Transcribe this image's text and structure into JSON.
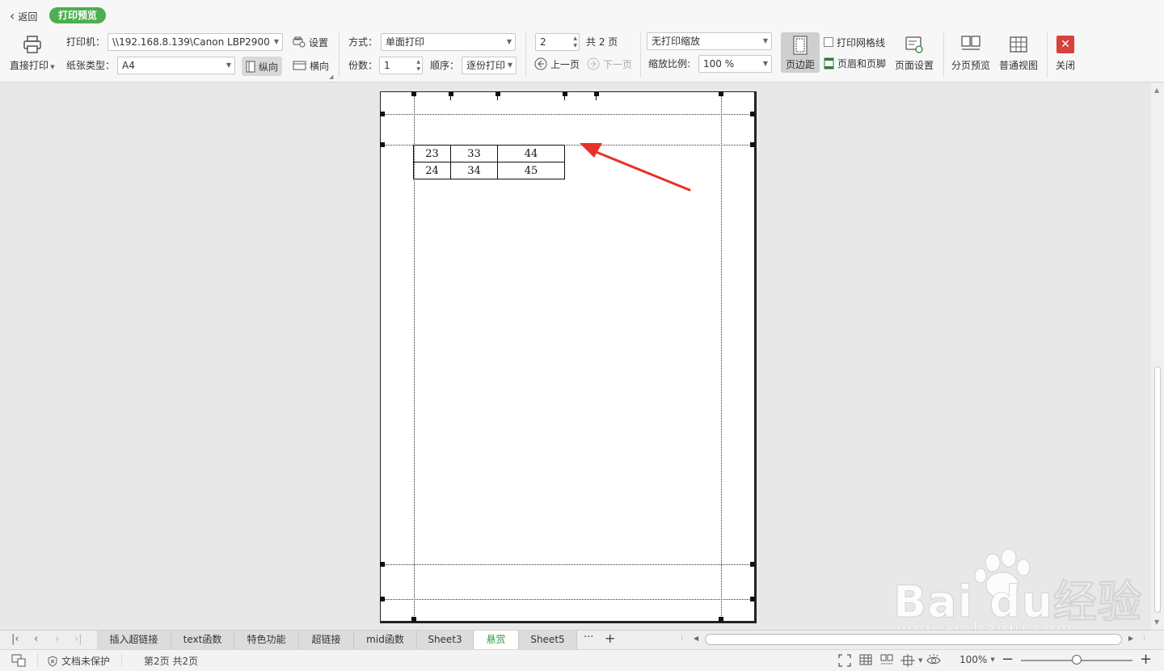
{
  "header": {
    "back_label": "返回",
    "mode_badge": "打印预览"
  },
  "toolbar": {
    "direct_print_label": "直接打印",
    "printer_label": "打印机：",
    "printer_value": "\\\\192.168.8.139\\Canon LBP2900",
    "settings_label": "设置",
    "paper_type_label": "纸张类型：",
    "paper_type_value": "A4",
    "portrait_label": "纵向",
    "landscape_label": "横向",
    "mode_label": "方式：",
    "mode_value": "单面打印",
    "copies_label": "份数：",
    "copies_value": "1",
    "order_label": "顺序：",
    "order_value": "逐份打印",
    "page_input_value": "2",
    "total_pages_label": "共 2 页",
    "prev_page_label": "上一页",
    "next_page_label": "下一页",
    "scaling_value": "无打印缩放",
    "zoom_ratio_label": "缩放比例:",
    "zoom_ratio_value": "100 %",
    "margins_label": "页边距",
    "print_gridlines_label": "打印网格线",
    "header_footer_label": "页眉和页脚",
    "page_setup_label": "页面设置",
    "page_break_preview_label": "分页预览",
    "normal_view_label": "普通视图",
    "close_label": "关闭"
  },
  "table": {
    "rows": [
      [
        "23",
        "33",
        "44"
      ],
      [
        "24",
        "34",
        "45"
      ]
    ]
  },
  "sheet_tabs": [
    {
      "label": "插入超链接",
      "active": false
    },
    {
      "label": "text函数",
      "active": false
    },
    {
      "label": "特色功能",
      "active": false
    },
    {
      "label": "超链接",
      "active": false
    },
    {
      "label": "mid函数",
      "active": false
    },
    {
      "label": "Sheet3",
      "active": false
    },
    {
      "label": "悬赏",
      "active": true
    },
    {
      "label": "Sheet5",
      "active": false
    }
  ],
  "tabs_more_label": "···",
  "tabs_add_label": "+",
  "status": {
    "protection_label": "文档未保护",
    "page_info": "第2页 共2页",
    "zoom_value": "100%"
  },
  "watermark": {
    "brand": "Bai du经验",
    "url": "jingyan.baidu.com"
  },
  "colors": {
    "accent_green": "#4caf50",
    "arrow_red": "#e8302a",
    "close_red": "#d9413d"
  }
}
